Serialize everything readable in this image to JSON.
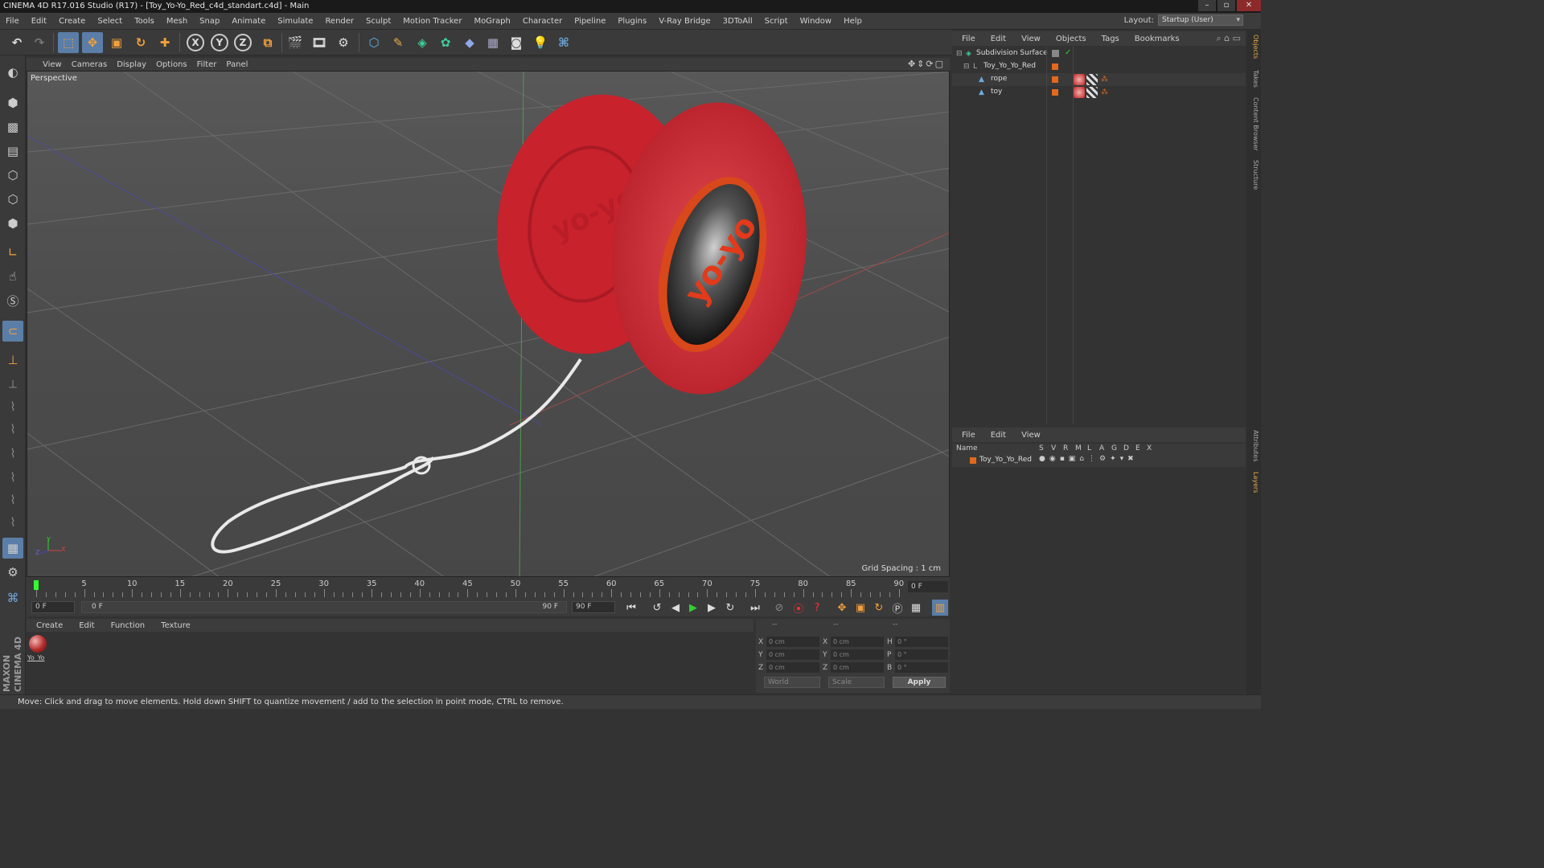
{
  "window": {
    "title": "CINEMA 4D R17.016 Studio (R17) - [Toy_Yo-Yo_Red_c4d_standart.c4d] - Main"
  },
  "menubar": [
    "File",
    "Edit",
    "Create",
    "Select",
    "Tools",
    "Mesh",
    "Snap",
    "Animate",
    "Simulate",
    "Render",
    "Sculpt",
    "Motion Tracker",
    "MoGraph",
    "Character",
    "Pipeline",
    "Plugins",
    "V-Ray Bridge",
    "3DToAll",
    "Script",
    "Window",
    "Help"
  ],
  "layout": {
    "label": "Layout:",
    "value": "Startup (User)"
  },
  "toolbar": {
    "axis_x": "X",
    "axis_y": "Y",
    "axis_z": "Z"
  },
  "viewport": {
    "menu": [
      "View",
      "Cameras",
      "Display",
      "Options",
      "Filter",
      "Panel"
    ],
    "label": "Perspective",
    "grid_spacing": "Grid Spacing : 1 cm",
    "axis_labels": {
      "x": "X",
      "y": "Y",
      "z": "Z"
    }
  },
  "timeline": {
    "ticks": [
      "0",
      "5",
      "10",
      "15",
      "20",
      "25",
      "30",
      "35",
      "40",
      "45",
      "50",
      "55",
      "60",
      "65",
      "70",
      "75",
      "80",
      "85",
      "90"
    ],
    "frame_display": "0 F",
    "start_field": "0 F",
    "range_start": "0 F",
    "range_end": "90 F",
    "end_field": "90 F"
  },
  "material_manager": {
    "menu": [
      "Create",
      "Edit",
      "Function",
      "Texture"
    ],
    "materials": [
      {
        "name": "Yo_Yo"
      }
    ]
  },
  "coordinates": {
    "header": [
      "--",
      "--",
      "--"
    ],
    "rows": [
      {
        "a1": "X",
        "v1": "0 cm",
        "a2": "X",
        "v2": "0 cm",
        "a3": "H",
        "v3": "0 °"
      },
      {
        "a1": "Y",
        "v1": "0 cm",
        "a2": "Y",
        "v2": "0 cm",
        "a3": "P",
        "v3": "0 °"
      },
      {
        "a1": "Z",
        "v1": "0 cm",
        "a2": "Z",
        "v2": "0 cm",
        "a3": "B",
        "v3": "0 °"
      }
    ],
    "space": "World",
    "mode": "Scale",
    "apply_label": "Apply"
  },
  "object_manager": {
    "menu": [
      "File",
      "Edit",
      "View",
      "Objects",
      "Tags",
      "Bookmarks"
    ],
    "objects": [
      {
        "name": "Subdivision Surface"
      },
      {
        "name": "Toy_Yo_Yo_Red"
      },
      {
        "name": "rope"
      },
      {
        "name": "toy"
      }
    ]
  },
  "layer_manager": {
    "menu": [
      "File",
      "Edit",
      "View"
    ],
    "columns": [
      "Name",
      "S",
      "V",
      "R",
      "M",
      "L",
      "A",
      "G",
      "D",
      "E",
      "X"
    ],
    "layers": [
      {
        "name": "Toy_Yo_Yo_Red",
        "color": "#e2691d"
      }
    ]
  },
  "side_tabs": [
    "Objects",
    "Takes",
    "Content Browser",
    "Structure",
    "Attributes",
    "Layers"
  ],
  "brand": "MAXON CINEMA 4D",
  "status": "Move: Click and drag to move elements. Hold down SHIFT to quantize movement / add to the selection in point mode, CTRL to remove."
}
